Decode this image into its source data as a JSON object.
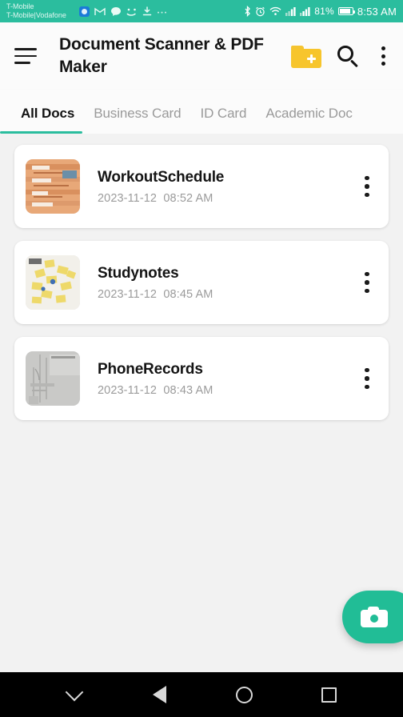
{
  "statusbar": {
    "carrier_line1": "T-Mobile",
    "carrier_line2": "T-Mobile|Vodafone",
    "battery": "81%",
    "time": "8:53 AM",
    "icons": [
      "blue-badge-icon",
      "gmail-icon",
      "chat-bubble-icon",
      "arabic-app-icon",
      "download-icon",
      "more-notifications-icon"
    ],
    "right_icons": [
      "bluetooth-icon",
      "alarm-icon",
      "wifi-icon",
      "signal-sim1-icon",
      "signal-sim2-icon",
      "battery-icon"
    ],
    "accent": "#2bbd9e"
  },
  "appbar": {
    "menu_icon": "hamburger-menu-icon",
    "title": "Document Scanner & PDF Maker",
    "add_folder_icon": "folder-add-icon",
    "search_icon": "search-icon",
    "overflow_icon": "overflow-menu-icon",
    "folder_color": "#f7c52c"
  },
  "tabs": {
    "items": [
      {
        "label": "All Docs",
        "active": true
      },
      {
        "label": "Business Card",
        "active": false
      },
      {
        "label": "ID Card",
        "active": false
      },
      {
        "label": "Academic Doc",
        "active": false
      }
    ],
    "indicator_color": "#2bbd9e"
  },
  "documents": [
    {
      "name": "WorkoutSchedule",
      "date": "2023-11-12",
      "time": "08:52 AM",
      "thumbnail": "orange-document-thumbnail",
      "overflow_icon": "overflow-menu-icon"
    },
    {
      "name": "Studynotes",
      "date": "2023-11-12",
      "time": "08:45 AM",
      "thumbnail": "yellow-sticky-notes-thumbnail",
      "overflow_icon": "overflow-menu-icon"
    },
    {
      "name": "PhoneRecords",
      "date": "2023-11-12",
      "time": "08:43 AM",
      "thumbnail": "grayscale-document-thumbnail",
      "overflow_icon": "overflow-menu-icon"
    }
  ],
  "fab": {
    "icon": "camera-icon",
    "color": "#21bd96"
  },
  "navbar": {
    "buttons": [
      {
        "icon": "chevron-down-icon"
      },
      {
        "icon": "back-icon"
      },
      {
        "icon": "home-icon"
      },
      {
        "icon": "recents-icon"
      }
    ]
  }
}
